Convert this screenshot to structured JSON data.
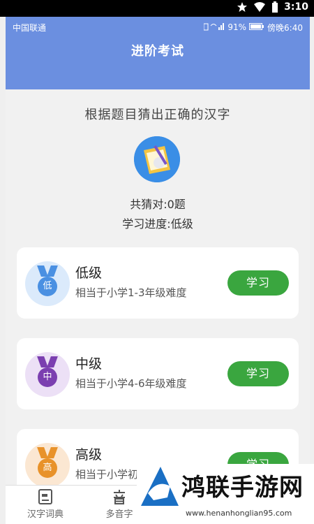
{
  "system": {
    "time": "3:10"
  },
  "phone_status": {
    "carrier": "中国联通",
    "battery": "91%",
    "time": "傍晚6:40"
  },
  "header": {
    "title": "进阶考试"
  },
  "subtitle": "根据题目猜出正确的汉字",
  "stats": {
    "correct": "共猜对:0题",
    "progress": "学习进度:低级"
  },
  "levels": [
    {
      "medal": "低",
      "name": "低级",
      "desc": "相当于小学1-3年级难度",
      "button": "学习",
      "color": "#4a90e2",
      "bg": "#dbeafb"
    },
    {
      "medal": "中",
      "name": "中级",
      "desc": "相当于小学4-6年级难度",
      "button": "学习",
      "color": "#7b3fb0",
      "bg": "#ece0f6"
    },
    {
      "medal": "高",
      "name": "高级",
      "desc": "相当于小学初中难度",
      "button": "学习",
      "color": "#e8922a",
      "bg": "#fbe7d2"
    }
  ],
  "bottom_nav": [
    {
      "label": "汉字词典",
      "icon": "dictionary-icon"
    },
    {
      "label": "多音字",
      "icon": "sound-icon"
    }
  ],
  "watermark": {
    "text": "鸿联手游网",
    "url": "www.henanhonglian95.com"
  }
}
